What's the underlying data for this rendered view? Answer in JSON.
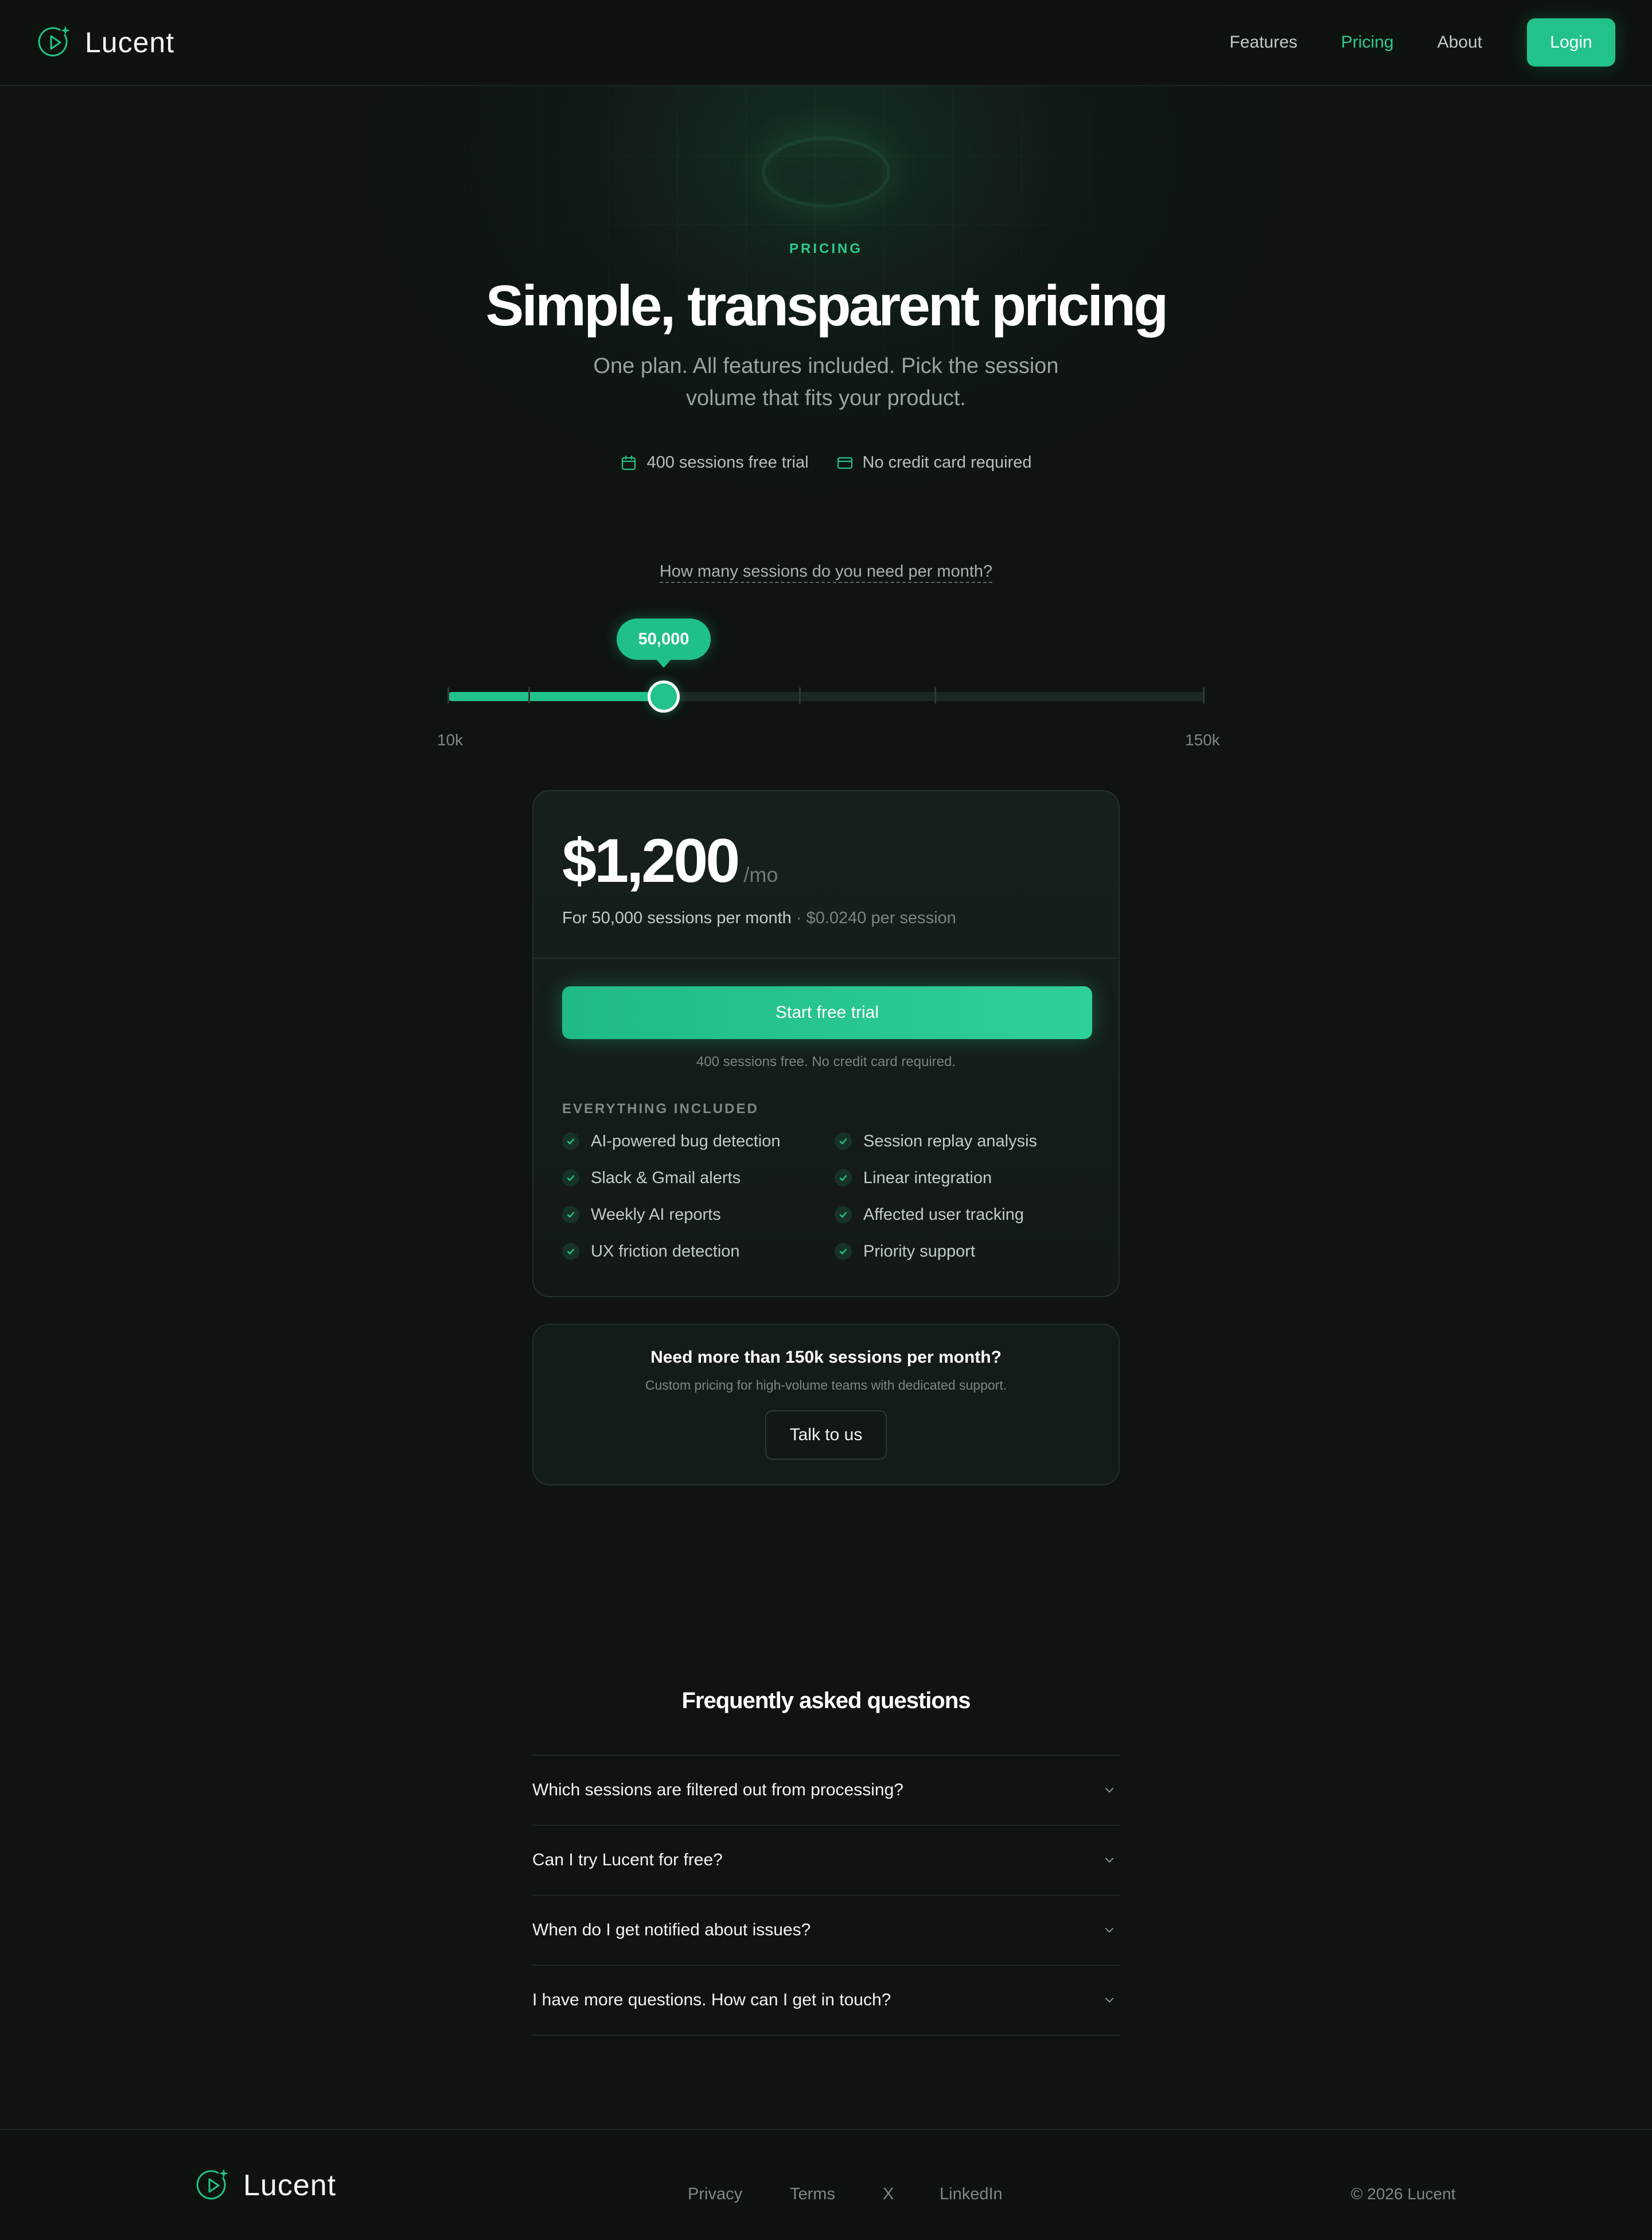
{
  "nav": {
    "brand": "Lucent",
    "links": [
      {
        "label": "Features",
        "active": false
      },
      {
        "label": "Pricing",
        "active": true
      },
      {
        "label": "About",
        "active": false
      }
    ],
    "login_label": "Login"
  },
  "hero": {
    "eyebrow": "PRICING",
    "title": "Simple, transparent pricing",
    "subtitle": "One plan. All features included. Pick the session volume that fits your product.",
    "badges": [
      {
        "icon": "calendar-icon",
        "label": "400 sessions free trial"
      },
      {
        "icon": "credit-card-icon",
        "label": "No credit card required"
      }
    ]
  },
  "slider": {
    "question": "How many sessions do you need per month?",
    "value_label": "50,000",
    "value": 50000,
    "min": 10000,
    "max": 150000,
    "min_label": "10k",
    "max_label": "150k",
    "tick_values": [
      10000,
      25000,
      50000,
      75000,
      100000,
      150000
    ]
  },
  "plan": {
    "price": "$1,200",
    "period": "/mo",
    "desc": "For 50,000 sessions per month",
    "separator": "·",
    "per_session": "$0.0240 per session",
    "cta_label": "Start free trial",
    "cta_note": "400 sessions free. No credit card required.",
    "included_heading": "EVERYTHING INCLUDED",
    "features": [
      "AI-powered bug detection",
      "Session replay analysis",
      "Slack & Gmail alerts",
      "Linear integration",
      "Weekly AI reports",
      "Affected user tracking",
      "UX friction detection",
      "Priority support"
    ]
  },
  "enterprise": {
    "title": "Need more than 150k sessions per month?",
    "subtitle": "Custom pricing for high-volume teams with dedicated support.",
    "button_label": "Talk to us"
  },
  "faq": {
    "title": "Frequently asked questions",
    "items": [
      "Which sessions are filtered out from processing?",
      "Can I try Lucent for free?",
      "When do I get notified about issues?",
      "I have more questions. How can I get in touch?"
    ]
  },
  "footer": {
    "brand": "Lucent",
    "links": [
      "Privacy",
      "Terms",
      "X",
      "LinkedIn"
    ],
    "copyright": "© 2026 Lucent"
  },
  "colors": {
    "accent": "#22c38b",
    "background": "#0f1411",
    "card": "#16201b"
  }
}
